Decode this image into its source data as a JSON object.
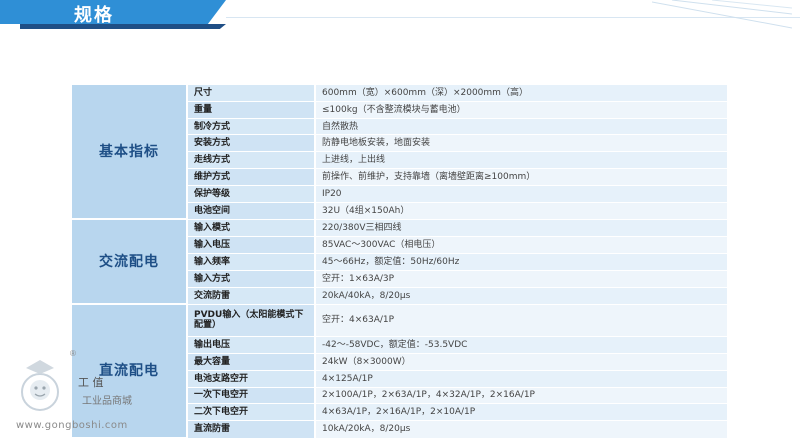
{
  "header": {
    "title": "规格"
  },
  "sections": [
    {
      "category": "基本指标",
      "rows": [
        {
          "name": "尺寸",
          "value": "600mm（宽）×600mm（深）×2000mm（高）"
        },
        {
          "name": "重量",
          "value": "≤100kg（不含整流模块与蓄电池）"
        },
        {
          "name": "制冷方式",
          "value": "自然散热"
        },
        {
          "name": "安装方式",
          "value": "防静电地板安装，地面安装"
        },
        {
          "name": "走线方式",
          "value": "上进线，上出线"
        },
        {
          "name": "维护方式",
          "value": "前操作、前维护，支持靠墙（离墙壁距离≥100mm）"
        },
        {
          "name": "保护等级",
          "value": "IP20"
        },
        {
          "name": "电池空间",
          "value": "32U（4组×150Ah）"
        }
      ]
    },
    {
      "category": "交流配电",
      "rows": [
        {
          "name": "输入模式",
          "value": "220/380V三相四线"
        },
        {
          "name": "输入电压",
          "value": "85VAC～300VAC（相电压）"
        },
        {
          "name": "输入频率",
          "value": "45～66Hz，额定值：50Hz/60Hz"
        },
        {
          "name": "输入方式",
          "value": "空开：1×63A/3P"
        },
        {
          "name": "交流防雷",
          "value": "20kA/40kA，8/20μs"
        }
      ]
    },
    {
      "category": "直流配电",
      "rows": [
        {
          "name": "PVDU输入（太阳能模式下配置）",
          "value": "空开：4×63A/1P"
        },
        {
          "name": "输出电压",
          "value": "-42～-58VDC，额定值：-53.5VDC"
        },
        {
          "name": "最大容量",
          "value": "24kW（8×3000W）"
        },
        {
          "name": "电池支路空开",
          "value": "4×125A/1P"
        },
        {
          "name": "一次下电空开",
          "value": "2×100A/1P，2×63A/1P，4×32A/1P，2×16A/1P"
        },
        {
          "name": "二次下电空开",
          "value": "4×63A/1P，2×16A/1P，2×10A/1P"
        },
        {
          "name": "直流防雷",
          "value": "10kA/20kA，8/20μs"
        }
      ]
    }
  ],
  "watermark": {
    "reg": "®",
    "line1": "工 值",
    "line2": "工业品商城",
    "url": "www.gongboshi.com"
  }
}
